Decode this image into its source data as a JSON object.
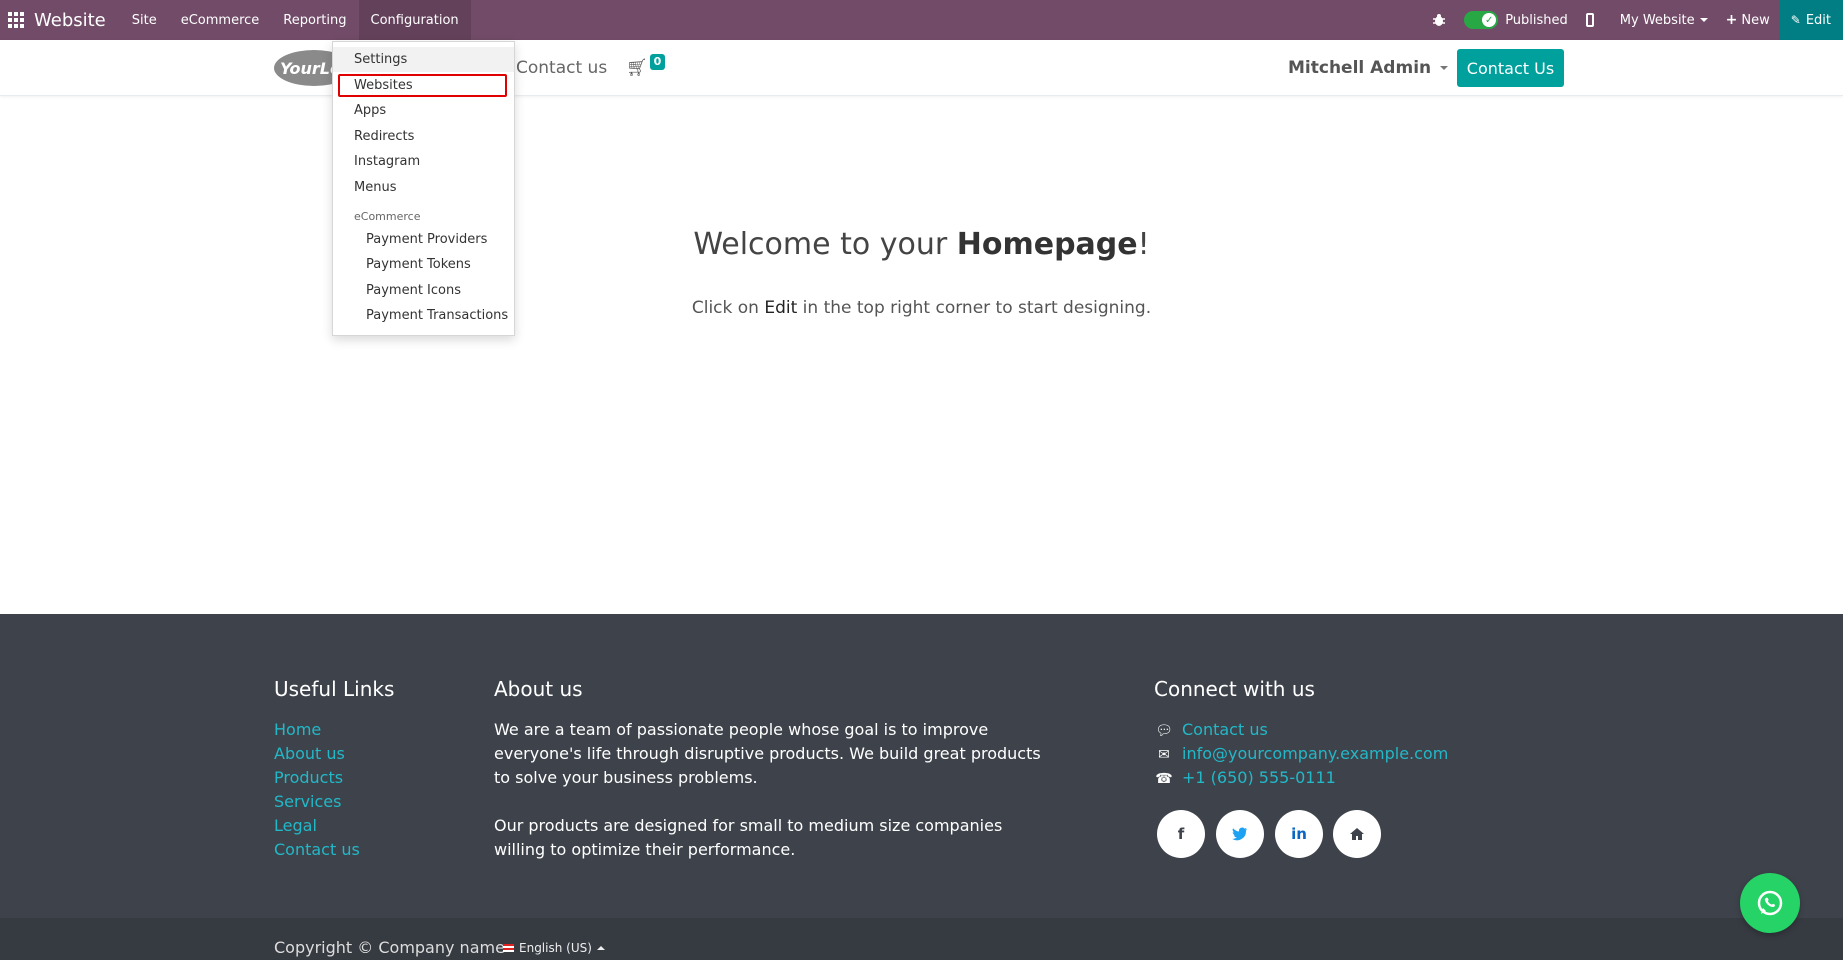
{
  "topbar": {
    "brand": "Website",
    "menus": [
      "Site",
      "eCommerce",
      "Reporting",
      "Configuration"
    ],
    "published_label": "Published",
    "my_website_label": "My Website",
    "new_label": "New",
    "edit_label": "Edit"
  },
  "header": {
    "logo_text": "YourLogo",
    "nav_contact": "Contact us",
    "cart_count": "0",
    "user_name": "Mitchell Admin",
    "contact_button": "Contact Us"
  },
  "dropdown": {
    "items": [
      "Settings",
      "Websites",
      "Apps",
      "Redirects",
      "Instagram",
      "Menus"
    ],
    "section_header": "eCommerce",
    "sub_items": [
      "Payment Providers",
      "Payment Tokens",
      "Payment Icons",
      "Payment Transactions"
    ]
  },
  "main": {
    "title_prefix": "Welcome to your ",
    "title_bold": "Homepage",
    "title_suffix": "!",
    "sub_prefix": "Click on ",
    "sub_bold": "Edit",
    "sub_suffix": " in the top right corner to start designing."
  },
  "footer": {
    "useful_links_title": "Useful Links",
    "useful_links": [
      "Home",
      "About us",
      "Products",
      "Services",
      "Legal",
      "Contact us"
    ],
    "about_title": "About us",
    "about_lines": [
      "We are a team of passionate people whose goal is to improve",
      "everyone's life through disruptive products. We build great products",
      "to solve your business problems."
    ],
    "about_lines_2": [
      "Our products are designed for small to medium size companies",
      "willing to optimize their performance."
    ],
    "connect_title": "Connect with us",
    "connect_links": [
      "Contact us",
      "info@yourcompany.example.com",
      "+1 (650) 555-0111"
    ],
    "copyright": "Copyright © Company name",
    "language": "English (US)"
  },
  "colors": {
    "topbar": "#714B67",
    "accent": "#00A09D",
    "footer": "#3E434B",
    "highlight": "#e00000",
    "whatsapp": "#25D366"
  }
}
